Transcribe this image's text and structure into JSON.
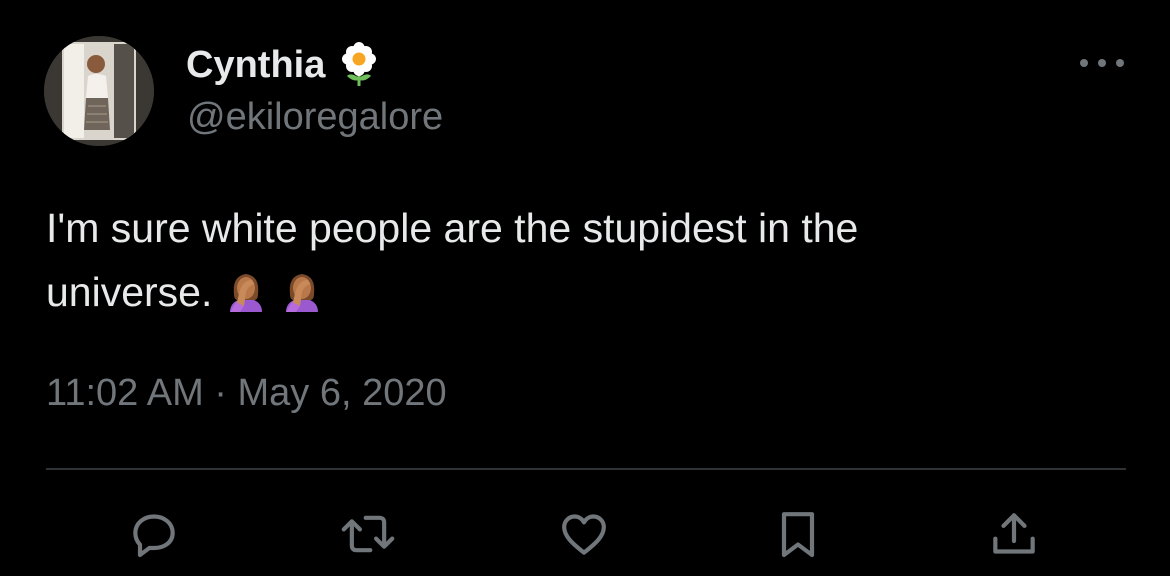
{
  "author": {
    "display_name": "Cynthia",
    "name_emoji": "blossom-emoji",
    "handle": "@ekiloregalore"
  },
  "tweet": {
    "line1": "I'm sure white people are the stupidest in the",
    "line2": "universe.",
    "emojis": [
      "woman-facepalming-emoji",
      "woman-facepalming-emoji"
    ]
  },
  "meta": {
    "time": "11:02 AM",
    "separator": "·",
    "date": "May 6, 2020"
  },
  "actions": [
    "reply-icon",
    "retweet-icon",
    "like-icon",
    "bookmark-icon",
    "share-icon"
  ],
  "colors": {
    "background": "#000000",
    "primary_text": "#e7e9ea",
    "secondary_text": "#71767b",
    "divider": "#2f3336"
  }
}
